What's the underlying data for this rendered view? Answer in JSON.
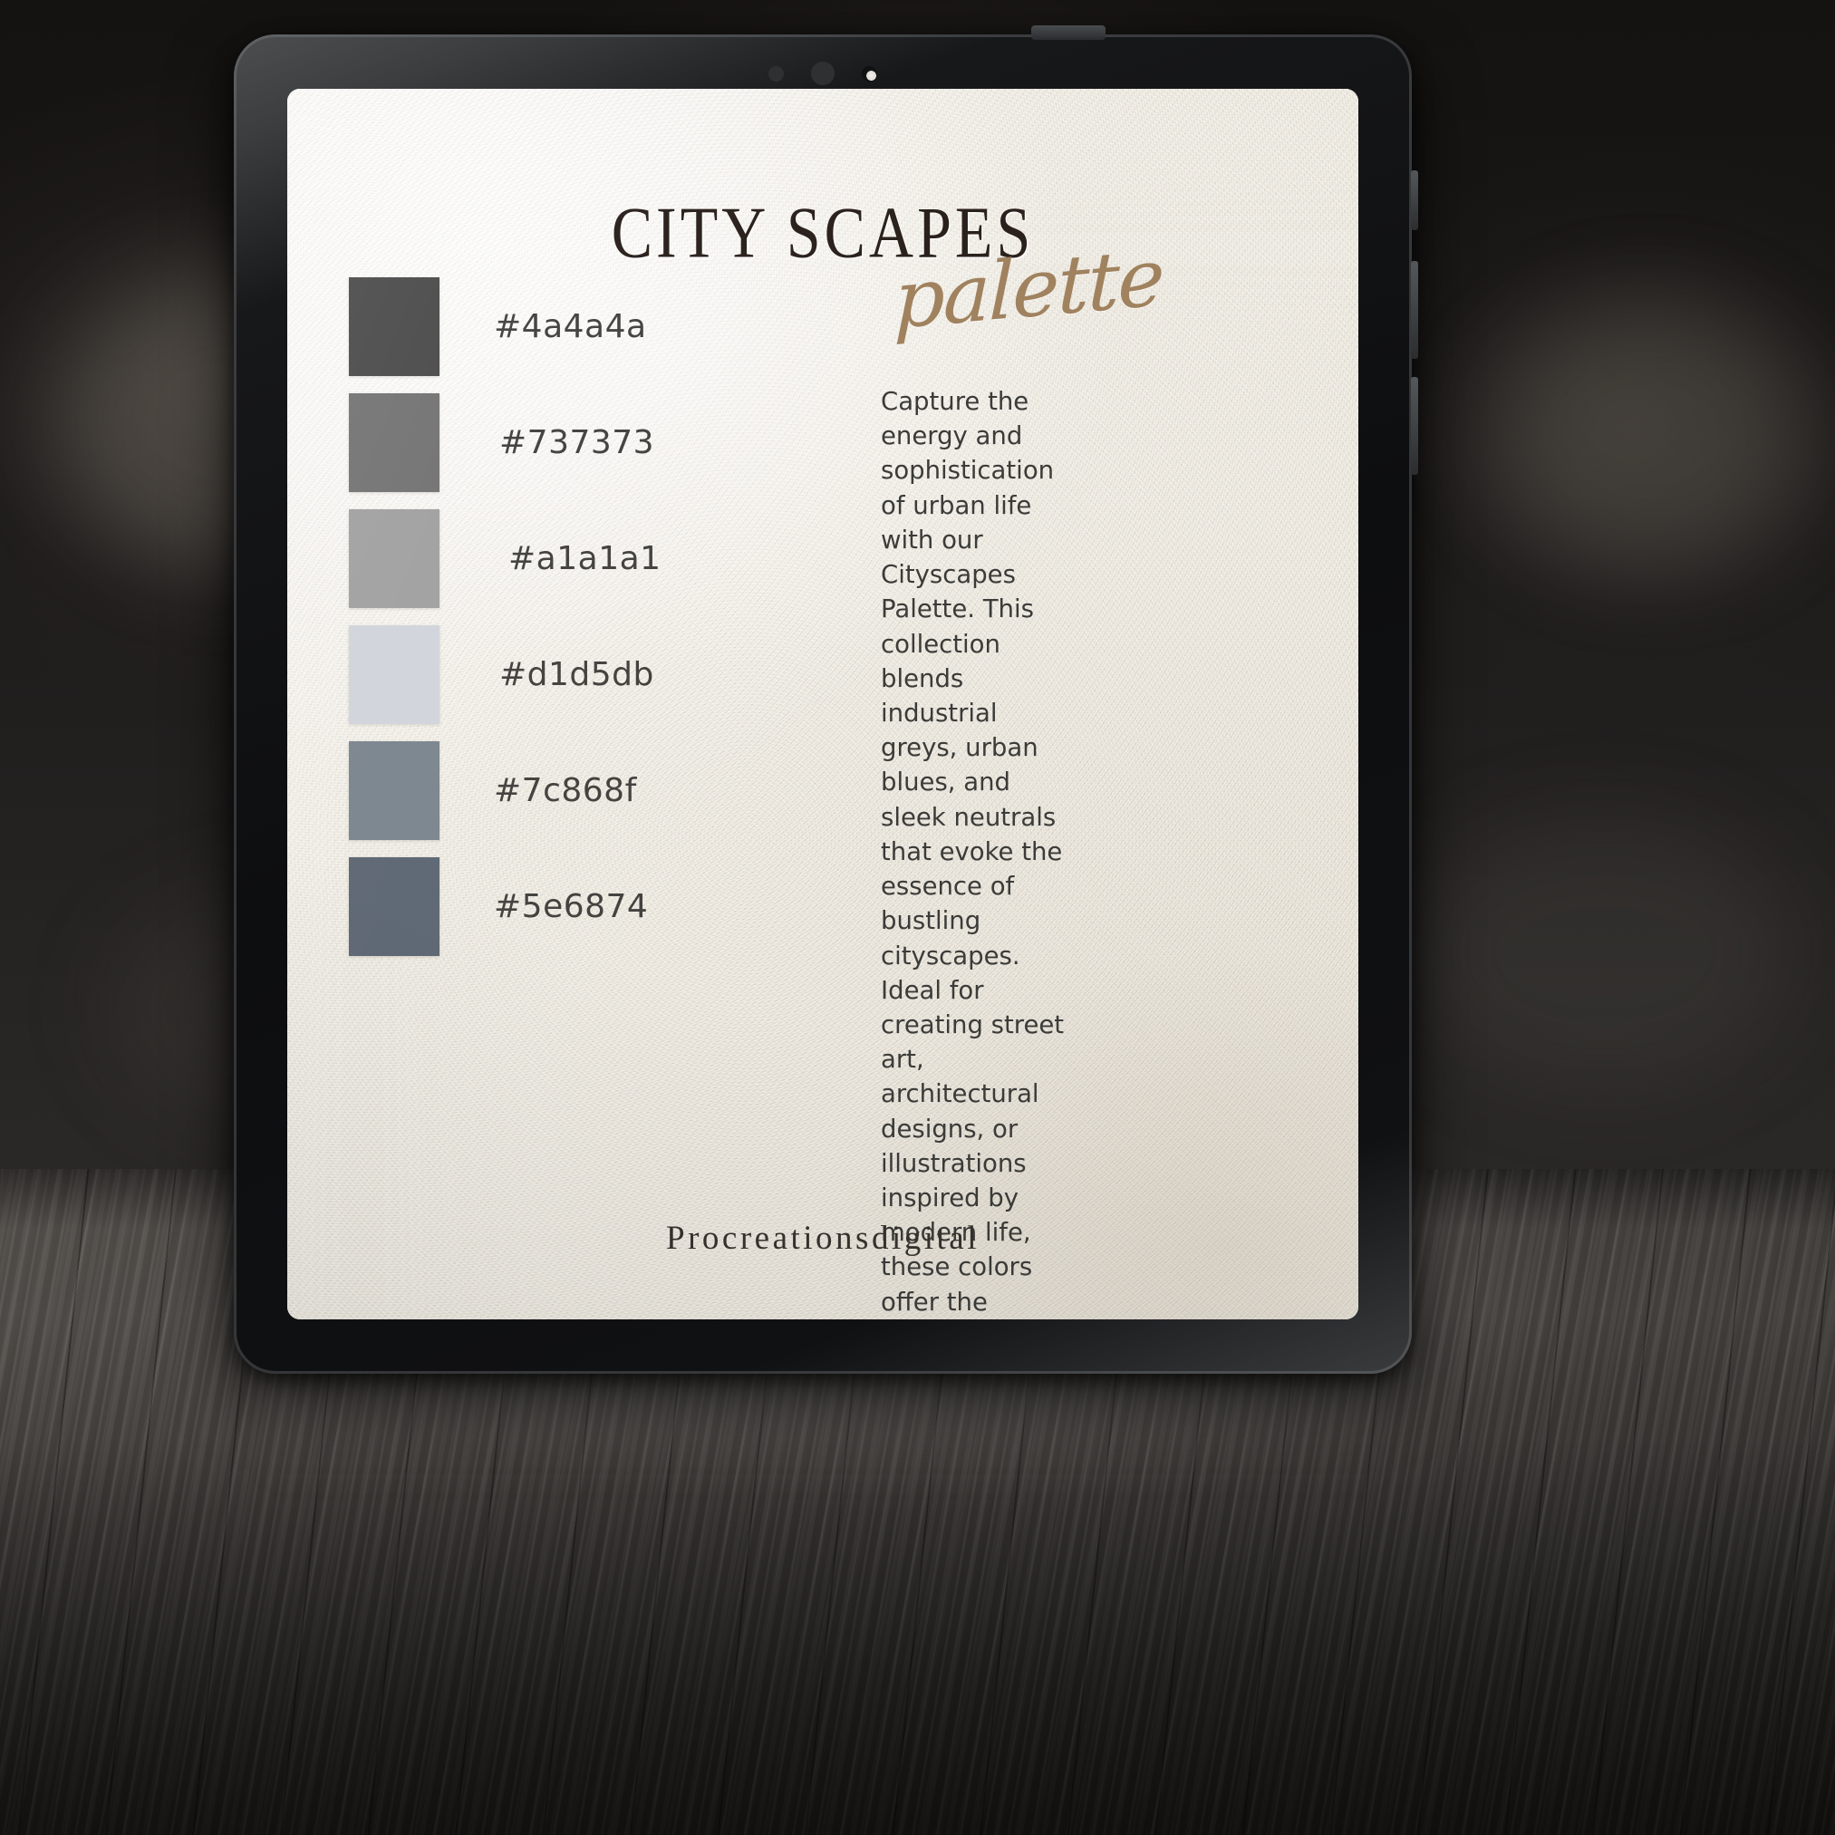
{
  "device": {
    "type": "tablet",
    "sensors": [
      "sensor-dot-small",
      "sensor-dot-mid",
      "front-camera"
    ]
  },
  "page": {
    "title": "CITY SCAPES",
    "script_label": "palette",
    "description": "Capture the energy and sophistication of urban life with our Cityscapes Palette. This collection blends industrial greys, urban blues, and sleek neutrals that evoke the essence of bustling cityscapes. Ideal for creating street art, architectural designs, or illustrations inspired by modern life, these colors offer the perfect balance of grit and elegance.",
    "footer": "Procreationsdigital",
    "background_color": "#f0ece3",
    "title_color": "#2b211c",
    "script_color": "#a0825f",
    "body_text_color": "#3b3b39"
  },
  "swatches": [
    {
      "hex": "#4a4a4a",
      "label": "#4a4a4a"
    },
    {
      "hex": "#737373",
      "label": "#737373"
    },
    {
      "hex": "#a1a1a1",
      "label": "#a1a1a1"
    },
    {
      "hex": "#d1d5db",
      "label": "#d1d5db"
    },
    {
      "hex": "#7c868f",
      "label": "#7c868f"
    },
    {
      "hex": "#5e6874",
      "label": "#5e6874"
    }
  ]
}
